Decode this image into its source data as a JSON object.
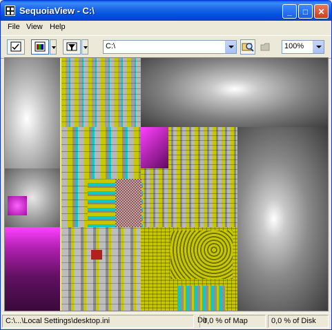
{
  "window": {
    "title": "SequoiaView - C:\\"
  },
  "title_buttons": {
    "minimize": "_",
    "maximize": "□",
    "close": "✕"
  },
  "menu": {
    "items": [
      "File",
      "View",
      "Help"
    ]
  },
  "toolbar": {
    "icons": [
      "checklist-icon",
      "colors-icon",
      "filter-icon",
      "search-folder-icon",
      "folder-icon"
    ],
    "path_value": "C:\\",
    "zoom_value": "100%"
  },
  "treemap": {
    "highlight_color": "#f0f060",
    "palette": [
      "#b8b8b8",
      "#c8c800",
      "#10c8c8",
      "#c020c0",
      "#c8c8c8",
      "#909090",
      "#b02020"
    ]
  },
  "status": {
    "path": "C:\\...\\Local Settings\\desktop.ini",
    "dir_label": "Dir :",
    "map_percent": "0,0 % of Map",
    "disk_percent": "0,0 % of Disk"
  }
}
